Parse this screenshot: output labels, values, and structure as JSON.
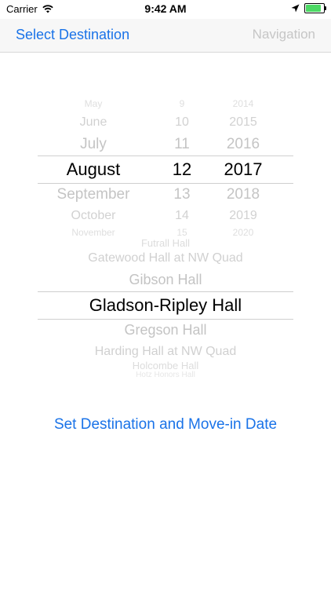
{
  "status_bar": {
    "carrier": "Carrier",
    "time": "9:42 AM",
    "battery_level": 0.85,
    "battery_color": "#4cd964"
  },
  "nav": {
    "left_title": "Select Destination",
    "right_label": "Navigation"
  },
  "date_picker": {
    "months": [
      "May",
      "June",
      "July",
      "August",
      "September",
      "October",
      "November"
    ],
    "days": [
      "9",
      "10",
      "11",
      "12",
      "13",
      "14",
      "15"
    ],
    "years": [
      "2014",
      "2015",
      "2016",
      "2017",
      "2018",
      "2019",
      "2020"
    ],
    "selected_index": 3
  },
  "hall_picker": {
    "items": [
      "Futrall Hall",
      "Gatewood Hall at NW Quad",
      "Gibson Hall",
      "Gladson-Ripley Hall",
      "Gregson Hall",
      "Harding Hall at NW Quad",
      "Holcombe Hall",
      "Hotz Honors Hall"
    ],
    "selected_index": 3
  },
  "action_label": "Set Destination and Move-in Date",
  "colors": {
    "accent": "#1a73e8",
    "disabled": "#c6c6c6",
    "picker_faded": "#b8b8b8"
  }
}
